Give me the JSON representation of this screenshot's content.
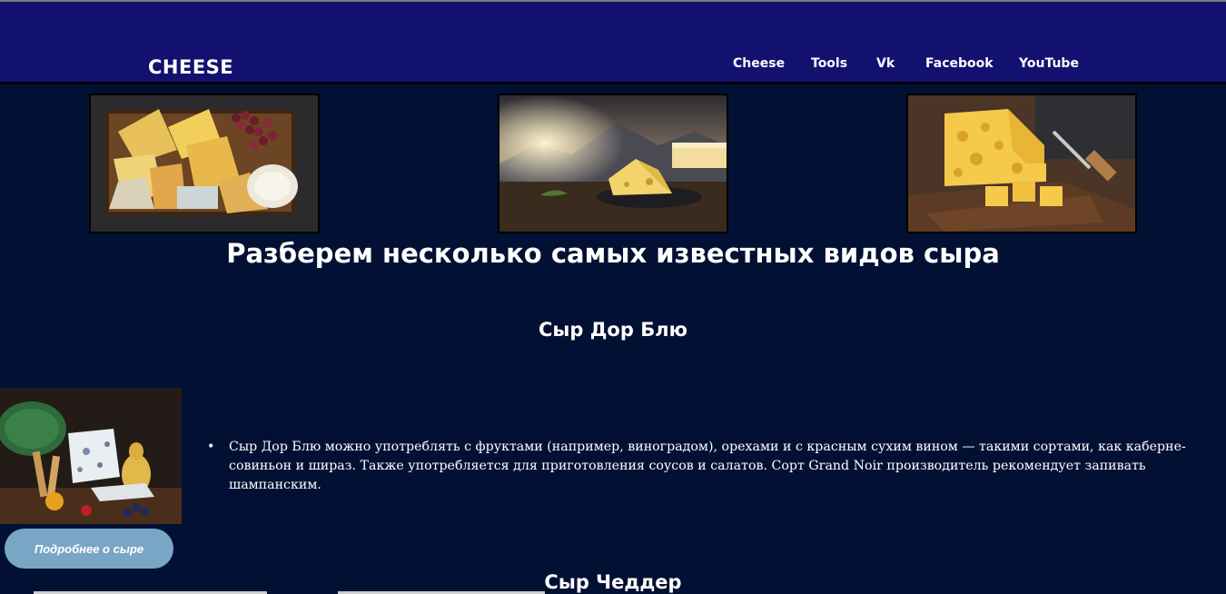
{
  "header": {
    "logo": "CHEESE",
    "nav": [
      {
        "label": "Cheese"
      },
      {
        "label": "Tools"
      },
      {
        "label": "Vk"
      },
      {
        "label": "Facebook"
      },
      {
        "label": "YouTube"
      }
    ]
  },
  "gallery": [
    {
      "icon": "cheese-platter-image"
    },
    {
      "icon": "cheese-on-plate-sunset-image"
    },
    {
      "icon": "swiss-cheese-board-image"
    }
  ],
  "main": {
    "heading": "Разберем несколько самых известных видов сыра",
    "sections": [
      {
        "title": "Сыр Дор Блю",
        "image_icon": "dor-blue-cheese-image",
        "bullet": "•",
        "text": "Сыр Дор Блю можно употреблять с фруктами (например, виноградом), орехами и с красным сухим вином — такими сортами, как каберне-совиньон и шираз. Также употребляется для приготовления соусов и салатов. Сорт Grand Noir производитель рекомендует запивать шампанским.",
        "button": "Подробнее о сыре"
      },
      {
        "title": "Сыр Чеддер"
      }
    ]
  },
  "colors": {
    "page_bg": "#021033",
    "header_bg": "#131170",
    "button_bg": "#7aa6c6"
  }
}
